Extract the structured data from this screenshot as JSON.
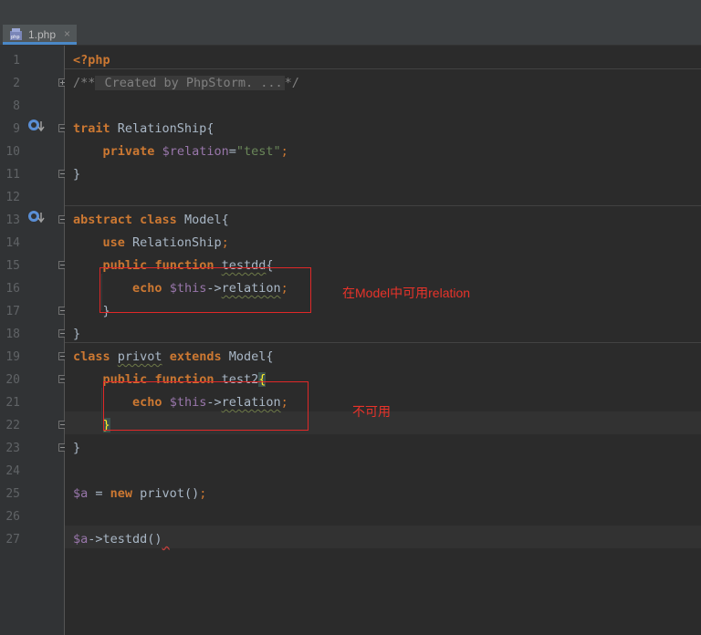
{
  "tab": {
    "filename": "1.php",
    "close": "×"
  },
  "lines": [
    {
      "no": "1"
    },
    {
      "no": "2"
    },
    {
      "no": "8"
    },
    {
      "no": "9"
    },
    {
      "no": "10"
    },
    {
      "no": "11"
    },
    {
      "no": "12"
    },
    {
      "no": "13"
    },
    {
      "no": "14"
    },
    {
      "no": "15"
    },
    {
      "no": "16"
    },
    {
      "no": "17"
    },
    {
      "no": "18"
    },
    {
      "no": "19"
    },
    {
      "no": "20"
    },
    {
      "no": "21"
    },
    {
      "no": "22"
    },
    {
      "no": "23"
    },
    {
      "no": "24"
    },
    {
      "no": "25"
    },
    {
      "no": "26"
    },
    {
      "no": "27"
    }
  ],
  "code": {
    "open_tag": "<?php",
    "doc_open": "/**",
    "doc_folded": " Created by PhpStorm. ...",
    "doc_close": "*/",
    "trait_kw": "trait",
    "trait_name": " RelationShip{",
    "private_kw": "private",
    "relation_var": "$relation",
    "eq": "=",
    "test_str": "\"test\"",
    "semi": ";",
    "close_brace": "}",
    "abstract_kw": "abstract",
    "class_kw": "class",
    "model_name": " Model{",
    "use_kw": "use",
    "use_target": " RelationShip",
    "public_kw": "public",
    "function_kw": "function",
    "testdd_name": "testdd",
    "open_brace": "{",
    "echo_kw": "echo",
    "this_var": "$this",
    "arrow": "->",
    "relation_prop": "relation",
    "privot_name": "privot",
    "extends_kw": "extends",
    "model_ref": " Model{",
    "test2_name": "test2",
    "a_var": "$a",
    "assign": " = ",
    "new_kw": "new",
    "privot_call": " privot()",
    "testdd_call": "testdd()"
  },
  "annotations": {
    "model_note": "在Model中可用relation",
    "privot_note": "不可用"
  },
  "colors": {
    "keyword": "#cc7832",
    "variable": "#9876aa",
    "string": "#6a8759",
    "annotation": "#e02828"
  }
}
